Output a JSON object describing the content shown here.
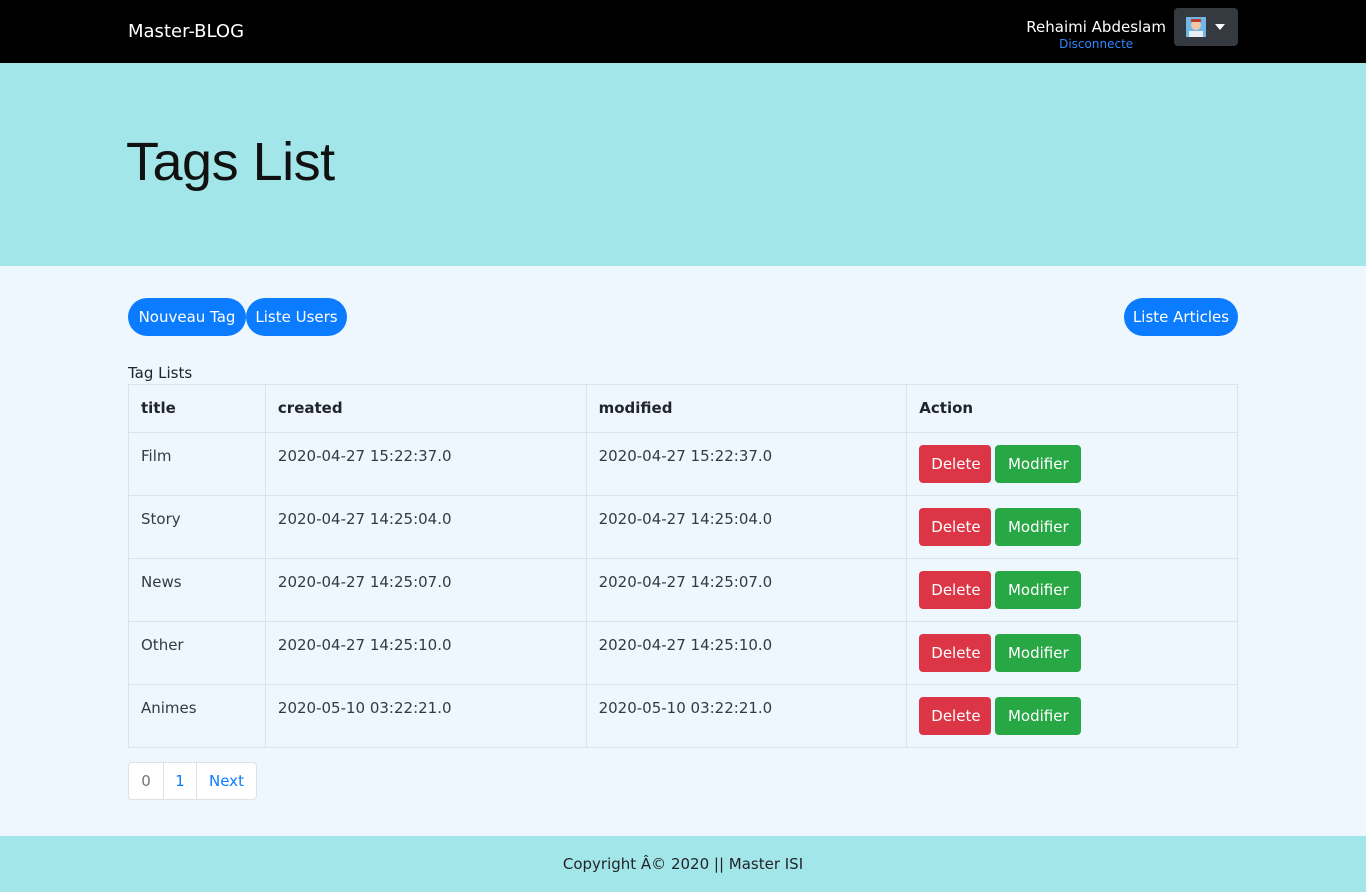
{
  "navbar": {
    "brand": "Master-BLOG",
    "user_name": "Rehaimi Abdeslam",
    "disconnect_label": "Disconnecte"
  },
  "header": {
    "title": "Tags List"
  },
  "actions": {
    "new_tag": "Nouveau Tag",
    "list_users": "Liste Users",
    "list_articles": "Liste Articles"
  },
  "table": {
    "caption": "Tag Lists",
    "columns": [
      "title",
      "created",
      "modified",
      "Action"
    ],
    "delete_label": "Delete",
    "modify_label": "Modifier",
    "rows": [
      {
        "title": "Film",
        "created": "2020-04-27 15:22:37.0",
        "modified": "2020-04-27 15:22:37.0"
      },
      {
        "title": "Story",
        "created": "2020-04-27 14:25:04.0",
        "modified": "2020-04-27 14:25:04.0"
      },
      {
        "title": "News",
        "created": "2020-04-27 14:25:07.0",
        "modified": "2020-04-27 14:25:07.0"
      },
      {
        "title": "Other",
        "created": "2020-04-27 14:25:10.0",
        "modified": "2020-04-27 14:25:10.0"
      },
      {
        "title": "Animes",
        "created": "2020-05-10 03:22:21.0",
        "modified": "2020-05-10 03:22:21.0"
      }
    ]
  },
  "pagination": {
    "pages": [
      "0",
      "1"
    ],
    "next_label": "Next"
  },
  "footer": {
    "text": "Copyright Â© 2020 || Master ISI"
  },
  "colors": {
    "navbar": "#000000",
    "jumbotron": "#a2e6e9",
    "primary": "#0b7bff",
    "danger": "#dc3545",
    "success": "#28a745",
    "background": "#eef7fe"
  }
}
